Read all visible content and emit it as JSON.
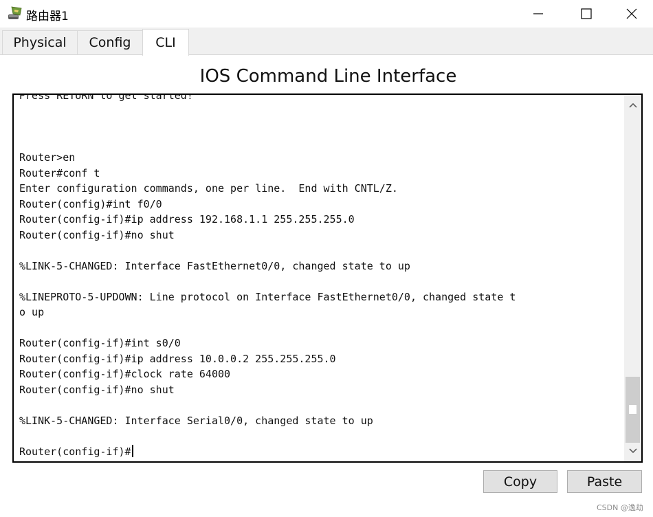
{
  "window": {
    "title": "路由器1",
    "icon": "router-app-icon",
    "controls": [
      "minimize-icon",
      "maximize-icon",
      "close-icon"
    ]
  },
  "tabs": [
    {
      "label": "Physical",
      "active": false
    },
    {
      "label": "Config",
      "active": false
    },
    {
      "label": "CLI",
      "active": true
    }
  ],
  "cli": {
    "heading": "IOS Command Line Interface",
    "terminal_lines": [
      "Press RETURN to get started!",
      "",
      "",
      "",
      "Router>en",
      "Router#conf t",
      "Enter configuration commands, one per line.  End with CNTL/Z.",
      "Router(config)#int f0/0",
      "Router(config-if)#ip address 192.168.1.1 255.255.255.0",
      "Router(config-if)#no shut",
      "",
      "%LINK-5-CHANGED: Interface FastEthernet0/0, changed state to up",
      "",
      "%LINEPROTO-5-UPDOWN: Line protocol on Interface FastEthernet0/0, changed state t",
      "o up",
      "",
      "Router(config-if)#int s0/0",
      "Router(config-if)#ip address 10.0.0.2 255.255.255.0",
      "Router(config-if)#clock rate 64000",
      "Router(config-if)#no shut",
      "",
      "%LINK-5-CHANGED: Interface Serial0/0, changed state to up",
      "",
      "Router(config-if)#"
    ],
    "scroll_position": 1.0
  },
  "buttons": {
    "copy": "Copy",
    "paste": "Paste"
  },
  "watermark": "CSDN @逸劫"
}
